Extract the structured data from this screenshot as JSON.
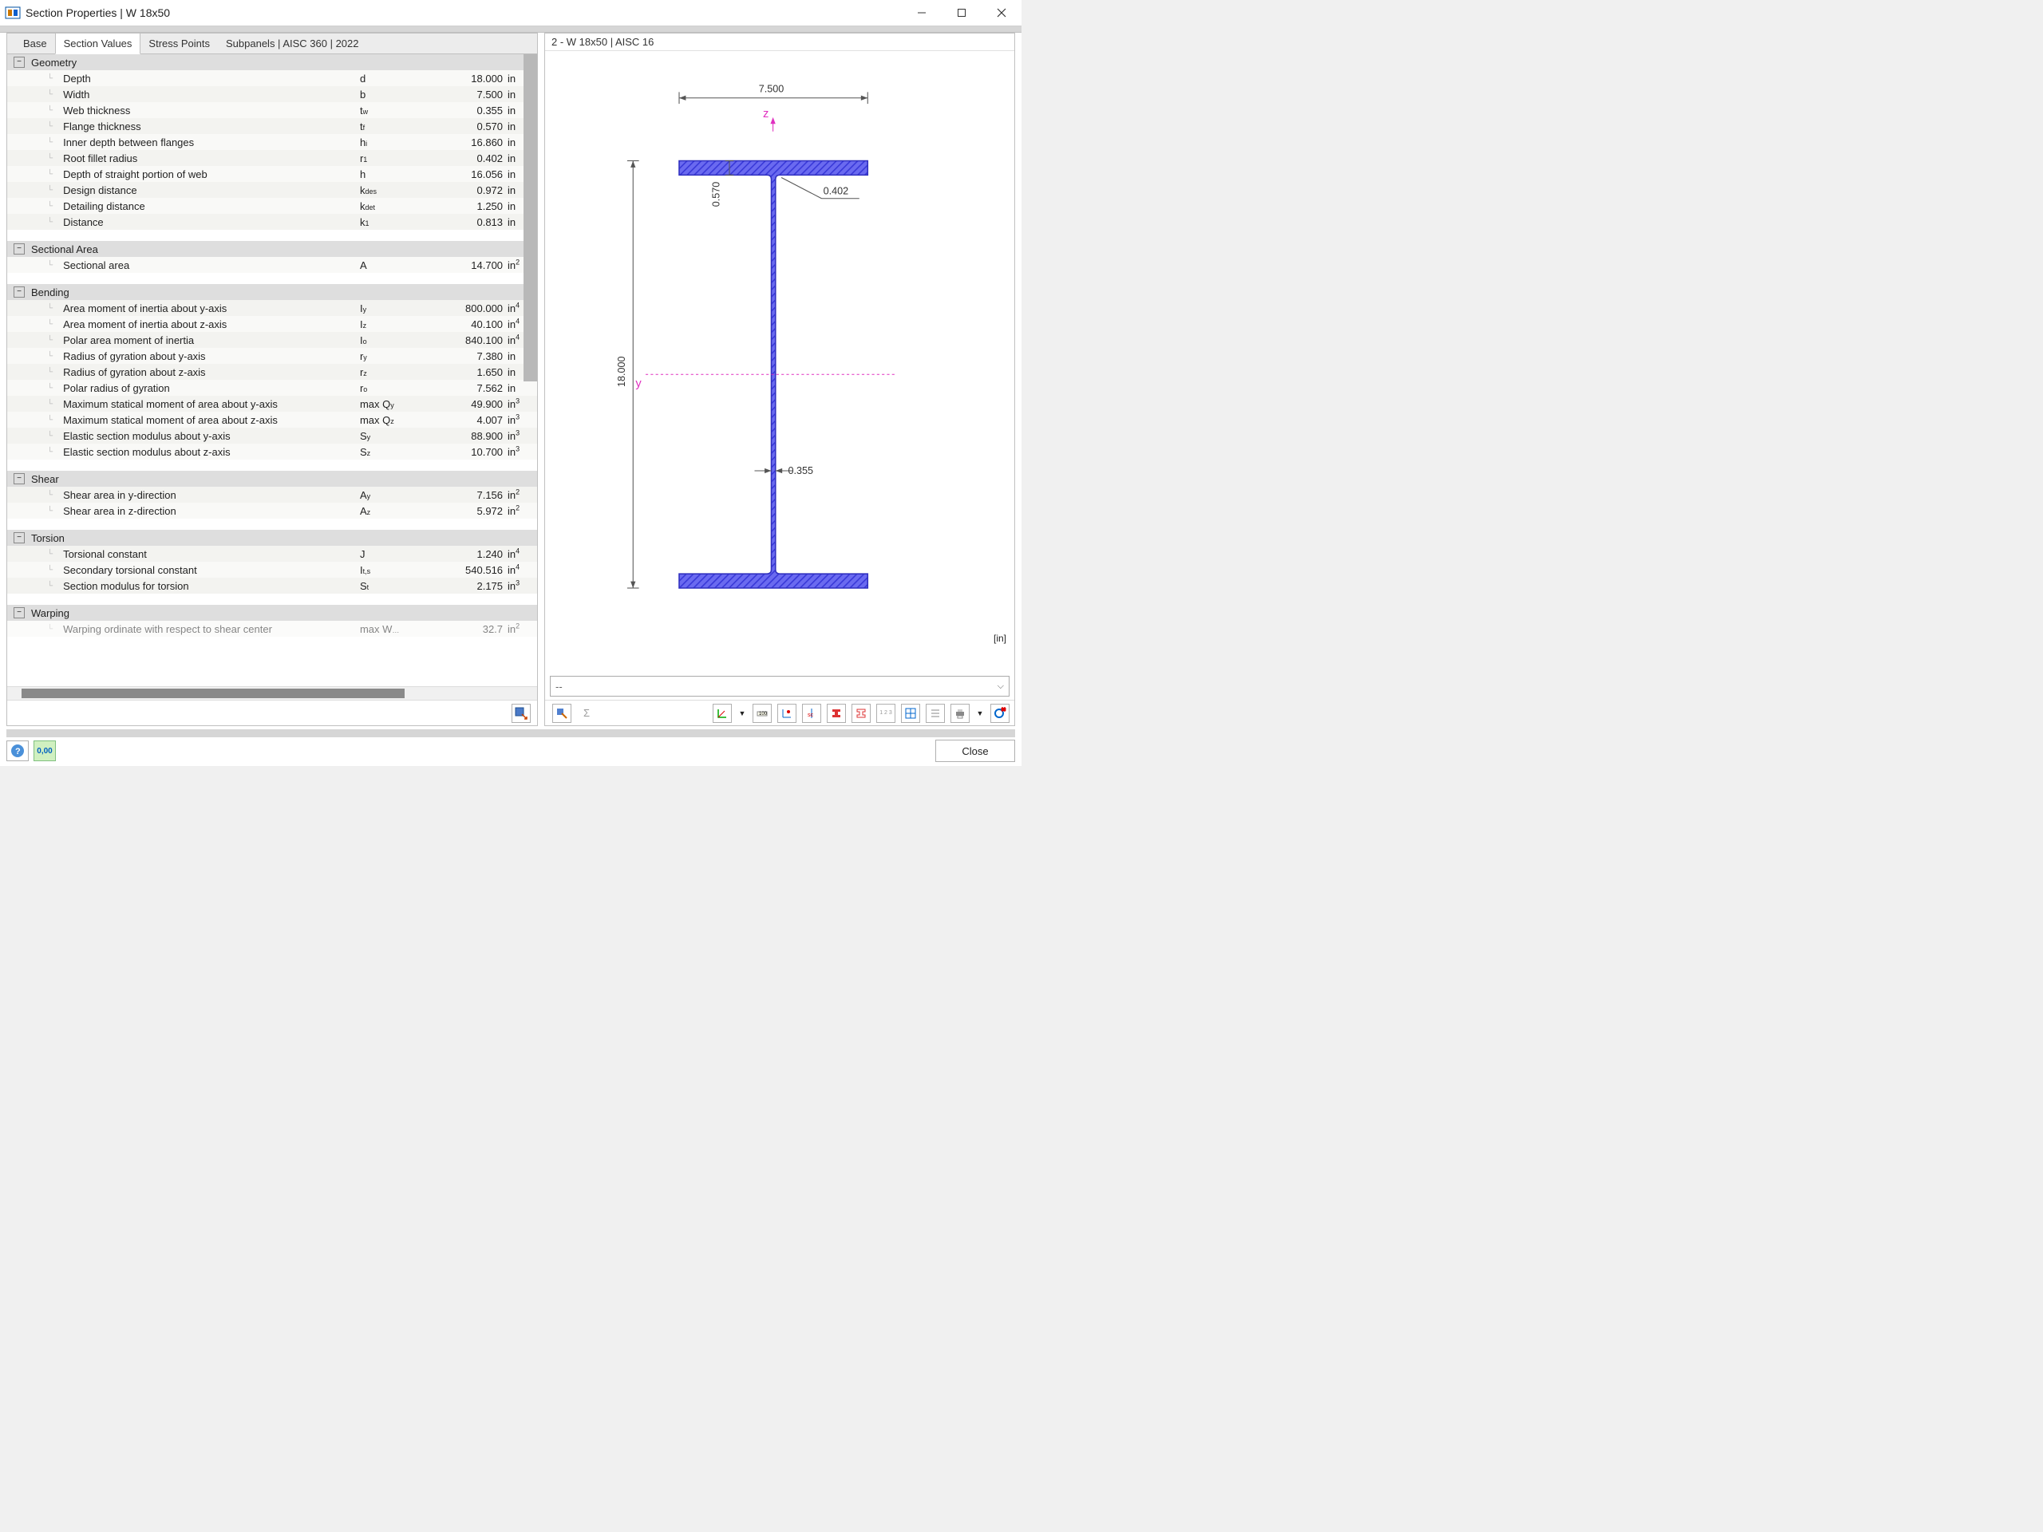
{
  "window": {
    "title": "Section Properties | W 18x50"
  },
  "tabs": [
    "Base",
    "Section Values",
    "Stress Points",
    "Subpanels | AISC 360 | 2022"
  ],
  "active_tab": 1,
  "sections": [
    {
      "name": "Geometry",
      "rows": [
        {
          "label": "Depth",
          "symbol": "d",
          "value": "18.000",
          "unit": "in"
        },
        {
          "label": "Width",
          "symbol": "b",
          "value": "7.500",
          "unit": "in"
        },
        {
          "label": "Web thickness",
          "symbol": "t",
          "sub": "w",
          "value": "0.355",
          "unit": "in"
        },
        {
          "label": "Flange thickness",
          "symbol": "t",
          "sub": "f",
          "value": "0.570",
          "unit": "in"
        },
        {
          "label": "Inner depth between flanges",
          "symbol": "h",
          "sub": "i",
          "value": "16.860",
          "unit": "in"
        },
        {
          "label": "Root fillet radius",
          "symbol": "r",
          "sub": "1",
          "value": "0.402",
          "unit": "in"
        },
        {
          "label": "Depth of straight portion of web",
          "symbol": "h",
          "value": "16.056",
          "unit": "in"
        },
        {
          "label": "Design distance",
          "symbol": "k",
          "sub": "des",
          "value": "0.972",
          "unit": "in"
        },
        {
          "label": "Detailing distance",
          "symbol": "k",
          "sub": "det",
          "value": "1.250",
          "unit": "in"
        },
        {
          "label": "Distance",
          "symbol": "k",
          "sub": "1",
          "value": "0.813",
          "unit": "in"
        }
      ]
    },
    {
      "name": "Sectional Area",
      "rows": [
        {
          "label": "Sectional area",
          "symbol": "A",
          "value": "14.700",
          "unit": "in",
          "sup": "2"
        }
      ]
    },
    {
      "name": "Bending",
      "rows": [
        {
          "label": "Area moment of inertia about y-axis",
          "symbol": "I",
          "sub": "y",
          "value": "800.000",
          "unit": "in",
          "sup": "4"
        },
        {
          "label": "Area moment of inertia about z-axis",
          "symbol": "I",
          "sub": "z",
          "value": "40.100",
          "unit": "in",
          "sup": "4"
        },
        {
          "label": "Polar area moment of inertia",
          "symbol": "I",
          "sub": "o",
          "value": "840.100",
          "unit": "in",
          "sup": "4"
        },
        {
          "label": "Radius of gyration about y-axis",
          "symbol": "r",
          "sub": "y",
          "value": "7.380",
          "unit": "in"
        },
        {
          "label": "Radius of gyration about z-axis",
          "symbol": "r",
          "sub": "z",
          "value": "1.650",
          "unit": "in"
        },
        {
          "label": "Polar radius of gyration",
          "symbol": "r",
          "sub": "o",
          "value": "7.562",
          "unit": "in"
        },
        {
          "label": "Maximum statical moment of area about y-axis",
          "symbol": "max Q",
          "sub": "y",
          "value": "49.900",
          "unit": "in",
          "sup": "3"
        },
        {
          "label": "Maximum statical moment of area about z-axis",
          "symbol": "max Q",
          "sub": "z",
          "value": "4.007",
          "unit": "in",
          "sup": "3"
        },
        {
          "label": "Elastic section modulus about y-axis",
          "symbol": "S",
          "sub": "y",
          "value": "88.900",
          "unit": "in",
          "sup": "3"
        },
        {
          "label": "Elastic section modulus about z-axis",
          "symbol": "S",
          "sub": "z",
          "value": "10.700",
          "unit": "in",
          "sup": "3"
        }
      ]
    },
    {
      "name": "Shear",
      "rows": [
        {
          "label": "Shear area in y-direction",
          "symbol": "A",
          "sub": "y",
          "value": "7.156",
          "unit": "in",
          "sup": "2"
        },
        {
          "label": "Shear area in z-direction",
          "symbol": "A",
          "sub": "z",
          "value": "5.972",
          "unit": "in",
          "sup": "2"
        }
      ]
    },
    {
      "name": "Torsion",
      "rows": [
        {
          "label": "Torsional constant",
          "symbol": "J",
          "value": "1.240",
          "unit": "in",
          "sup": "4"
        },
        {
          "label": "Secondary torsional constant",
          "symbol": "I",
          "sub": "t,s",
          "value": "540.516",
          "unit": "in",
          "sup": "4"
        },
        {
          "label": "Section modulus for torsion",
          "symbol": "S",
          "sub": "t",
          "value": "2.175",
          "unit": "in",
          "sup": "3"
        }
      ]
    },
    {
      "name": "Warping",
      "rows": [
        {
          "label": "Warping ordinate with respect to shear center",
          "symbol": "max W",
          "sub": "…",
          "value": "32.7",
          "unit": "in",
          "sup": "2",
          "cutoff": true
        }
      ]
    }
  ],
  "preview": {
    "title": "2 - W 18x50 | AISC 16",
    "unit_label": "[in]",
    "dimensions": {
      "width": "7.500",
      "depth": "18.000",
      "flange": "0.570",
      "web": "0.355",
      "radius": "0.402"
    },
    "axes": {
      "y": "y",
      "z": "z"
    },
    "dropdown": "--"
  },
  "footer": {
    "close": "Close",
    "format": "0,00"
  }
}
